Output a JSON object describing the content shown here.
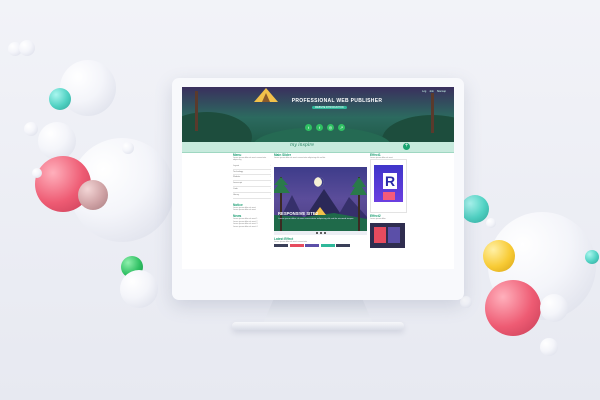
{
  "hero": {
    "title": "PROFESSIONAL WEB PUBLISHER",
    "badge": "WEBSITE INTRODUCTION",
    "top_links": [
      "Log",
      "Join",
      "Sitemap"
    ],
    "social_icons": [
      "twitter-icon",
      "facebook-icon",
      "instagram-icon",
      "share-icon"
    ]
  },
  "subnav": {
    "script": "my inspire"
  },
  "left": {
    "menu_title": "Menu",
    "menu_desc": "Lorem ipsum dolor sit amet consectetur adipiscing",
    "menu_items": [
      "Layout",
      "Technology",
      "Website",
      "Javascript",
      "Code",
      "Library"
    ],
    "notice_title": "Notice",
    "notice_lines": [
      "Lorem ipsum dolor sit amet",
      "Lorem ipsum dolor sit amet"
    ],
    "news_title": "News",
    "news_lines": [
      "Lorem ipsum dolor sit amet 1",
      "Lorem ipsum dolor sit amet 2",
      "Lorem ipsum dolor sit amet 3",
      "Lorem ipsum dolor sit amet 4"
    ]
  },
  "center": {
    "title": "Main Slider",
    "desc": "Lorem ipsum dolor sit amet consectetur adipiscing elit sed do",
    "slide_title": "RESPONSIVE SITE2",
    "slide_desc": "Lorem ipsum dolor sit amet consectetur adipiscing elit sed do eiusmod tempor",
    "latest_title": "Latest Effect",
    "latest_desc": "Lorem ipsum dolor sit amet consectetur"
  },
  "right": {
    "effect1_title": "Effect1",
    "effect1_desc": "Lorem ipsum dolor sit amet",
    "effect2_title": "Effect2",
    "effect2_desc": "Lorem ipsum dolor"
  },
  "colors": {
    "accent": "#1a9e72",
    "hero_bg": "#2c6a5f",
    "subnav_bg": "#c7eadd"
  }
}
